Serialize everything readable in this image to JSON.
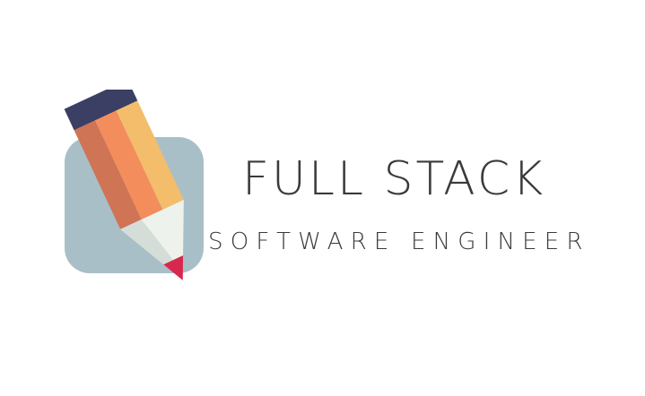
{
  "logo": {
    "title": "FULL STACK",
    "subtitle": "SOFTWARE ENGINEER",
    "icon": "pencil-icon",
    "colors": {
      "background_square": "#a9bfc8",
      "pencil_ferrule": "#3b3f63",
      "pencil_body_dark": "#cf7455",
      "pencil_body_mid": "#f48d5c",
      "pencil_body_light": "#f3bd6c",
      "pencil_wood": "#eef2ec",
      "pencil_tip": "#d8284f",
      "text": "#3a3a3a"
    }
  }
}
